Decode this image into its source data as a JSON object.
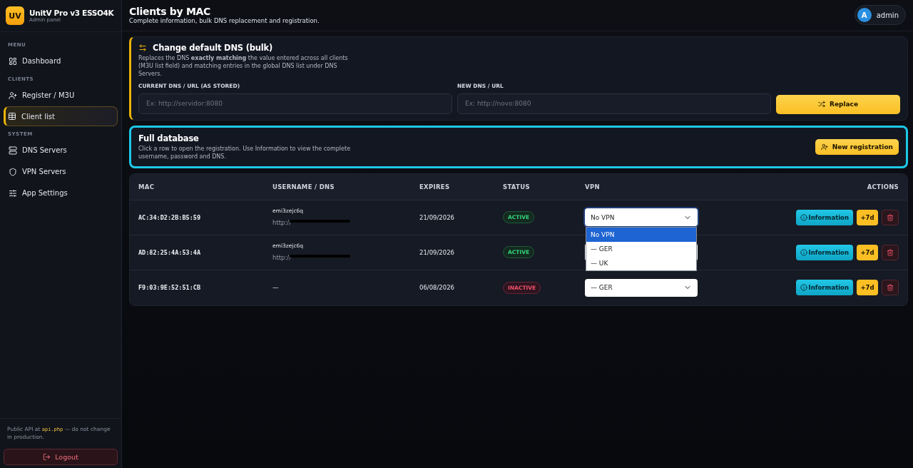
{
  "brand": {
    "logo": "UV",
    "title": "UnitV Pro v3 ESSO4K",
    "subtitle": "Admin panel"
  },
  "sidebar": {
    "sections": [
      {
        "label": "MENU",
        "items": [
          {
            "label": "Dashboard",
            "selected": false
          }
        ]
      },
      {
        "label": "CLIENTS",
        "items": [
          {
            "label": "Register / M3U",
            "selected": false
          },
          {
            "label": "Client list",
            "selected": true
          }
        ]
      },
      {
        "label": "SYSTEM",
        "items": [
          {
            "label": "DNS Servers",
            "selected": false
          },
          {
            "label": "VPN Servers",
            "selected": false
          },
          {
            "label": "App Settings",
            "selected": false
          }
        ]
      }
    ],
    "note": {
      "before": "Public API at ",
      "code": "api.php",
      "after": " — do not change in production."
    },
    "logout": "Logout"
  },
  "header": {
    "title": "Clients by MAC",
    "subtitle": "Complete information, bulk DNS replacement and registration.",
    "user": {
      "initial": "A",
      "name": "admin"
    }
  },
  "bulk_dns": {
    "title": "Change default DNS (bulk)",
    "description": "Replaces the DNS **exactly matching** the value entered across all clients (M3U list field) and matching entries in the global DNS list under DNS Servers.",
    "current": {
      "label": "CURRENT DNS / URL (AS STORED)",
      "placeholder": "Ex: http://servidor:8080"
    },
    "new": {
      "label": "NEW DNS / URL",
      "placeholder": "Ex: http://novo:8080"
    },
    "button": "Replace"
  },
  "database": {
    "title": "Full database",
    "description": "Click a row to open the registration. Use Information to view the complete username, password and DNS.",
    "button": "New registration"
  },
  "table": {
    "columns": [
      "MAC",
      "USERNAME / DNS",
      "EXPIRES",
      "STATUS",
      "VPN",
      "ACTIONS"
    ],
    "rows": [
      {
        "mac": "AC:34:D2:2B:B5:59",
        "username": "emi3zejc6q",
        "dns": "http://",
        "expires": "21/09/2026",
        "status": "ACTIVE",
        "active": true,
        "vpn": "No VPN",
        "vpn_open": true,
        "info": "Information",
        "extend": "+7d"
      },
      {
        "mac": "AD:82:25:4A:53:4A",
        "username": "emi3zejc6q",
        "dns": "http://",
        "expires": "21/09/2026",
        "status": "ACTIVE",
        "active": true,
        "vpn_open": false,
        "info": "Information",
        "extend": "+7d"
      },
      {
        "mac": "F9:03:9E:52:51:CB",
        "username": "—",
        "expires": "06/08/2026",
        "status": "INACTIVE",
        "active": false,
        "vpn": "— GER",
        "vpn_open": false,
        "info": "Information",
        "extend": "+7d"
      }
    ],
    "vpn_options": [
      {
        "label": "No VPN",
        "selected": true
      },
      {
        "label": "— GER",
        "selected": false
      },
      {
        "label": "— UK",
        "selected": false
      }
    ]
  }
}
